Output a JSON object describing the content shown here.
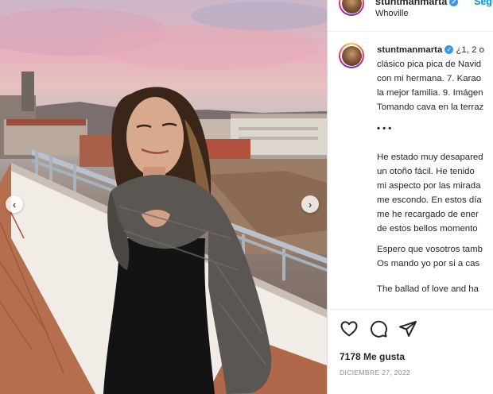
{
  "post": {
    "username": "stuntmanmarta",
    "location": "Whoville",
    "follow_label": "Segu",
    "verified_mark": "✓"
  },
  "photo": {
    "prev_arrow": "‹",
    "next_arrow": "›",
    "sky_colors": [
      "#cbb7c7",
      "#e6b2bf",
      "#b8b5b7"
    ]
  },
  "caption": {
    "username": "stuntmanmarta",
    "lines": [
      "¿1, 2 o",
      "clásico pica pica de Navid",
      "con mi hermana. 7. Karao",
      "la mejor familia. 9. Imágen",
      "Tomando cava en la terraz",
      "• • •",
      "He estado muy desapared",
      "un otoño fácil. He tenido",
      "mi aspecto por las mirada",
      "me escondo. En estos día",
      "me he recargado de ener",
      "de estos bellos momento",
      "Espero que vosotros tamb",
      "Os mando yo por si a cas",
      "The ballad of love and ha"
    ]
  },
  "actions": {
    "like_icon": "heart-icon",
    "comment_icon": "comment-icon",
    "share_icon": "paper-plane-icon",
    "likes_text": "7178 Me gusta",
    "date_text": "DICIEMBRE 27, 2022"
  },
  "colors": {
    "verified": "#3897f0",
    "follow": "#0095f6",
    "text": "#262626",
    "muted": "#8e8e8e"
  }
}
